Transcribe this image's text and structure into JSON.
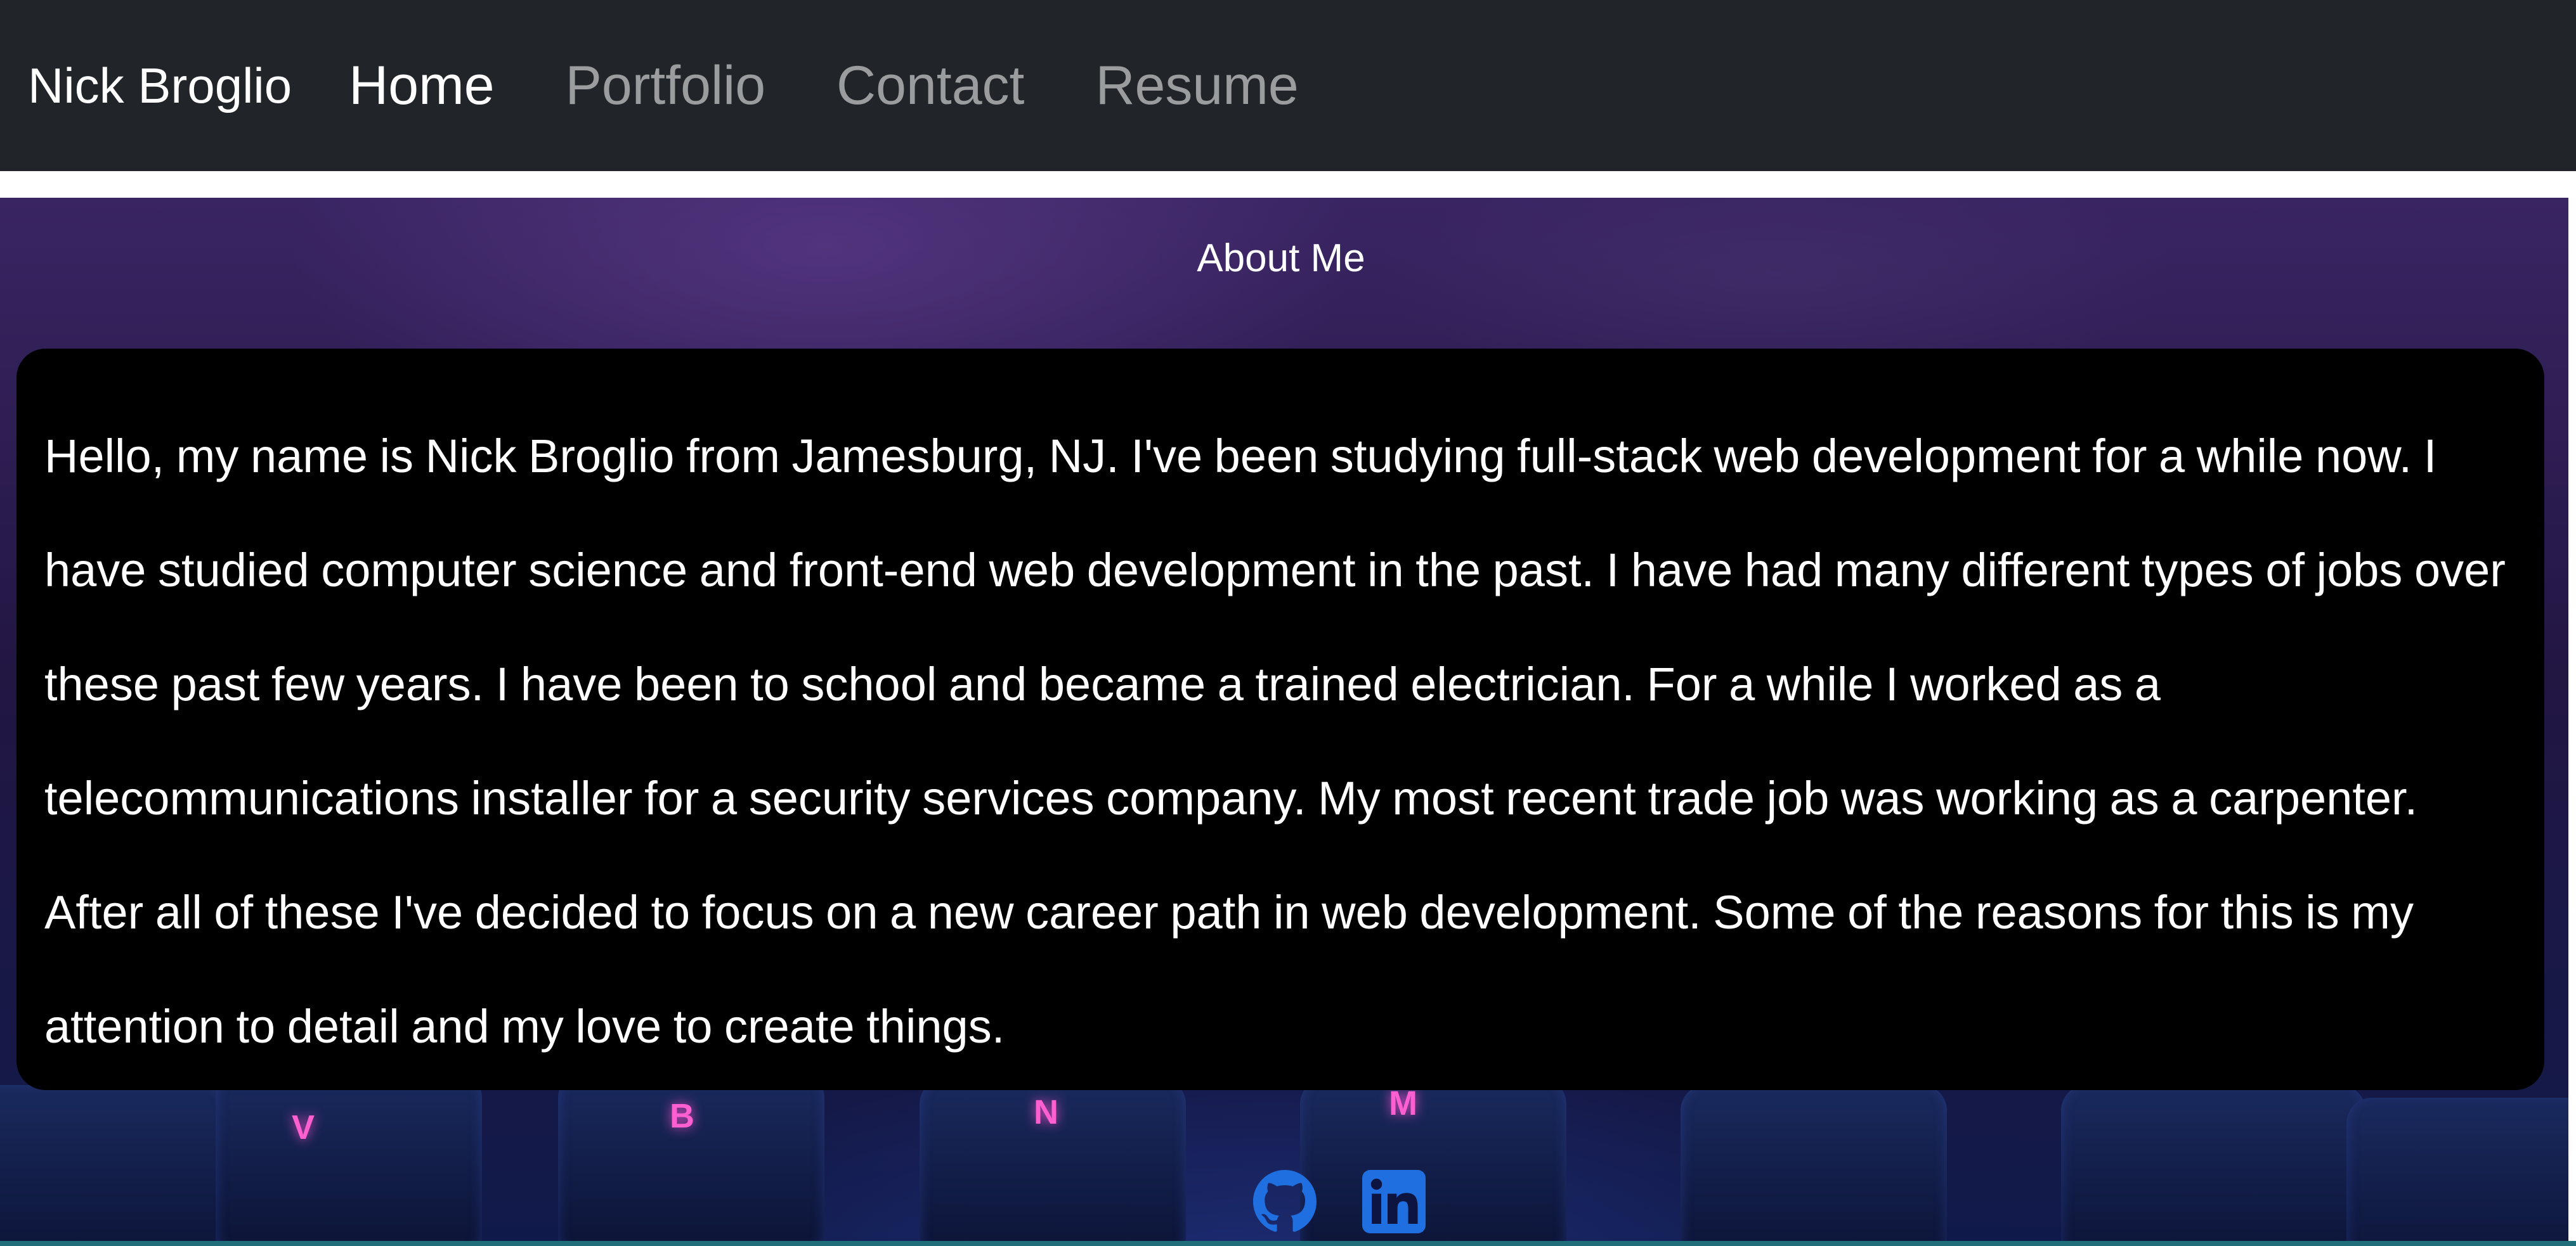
{
  "navbar": {
    "brand": "Nick Broglio",
    "links": [
      {
        "label": "Home",
        "active": true
      },
      {
        "label": "Portfolio",
        "active": false
      },
      {
        "label": "Contact",
        "active": false
      },
      {
        "label": "Resume",
        "active": false
      }
    ]
  },
  "about": {
    "title": "About Me",
    "body": "Hello, my name is Nick Broglio from Jamesburg, NJ. I've been studying full-stack web development for a while now. I have studied computer science and front-end web development in the past. I have had many different types of jobs over these past few years. I have been to school and became a trained electrician. For a while I worked as a telecommunications installer for a security services company. My most recent trade job was working as a carpenter. After all of these I've decided to focus on a new career path in web development. Some of the reasons for this is my attention to detail and my love to create things."
  },
  "social": {
    "icons": [
      "github-icon",
      "linkedin-icon"
    ]
  },
  "colors": {
    "navbar_bg": "#212529",
    "card_bg": "#000000",
    "social_blue": "#1f6fe0"
  }
}
